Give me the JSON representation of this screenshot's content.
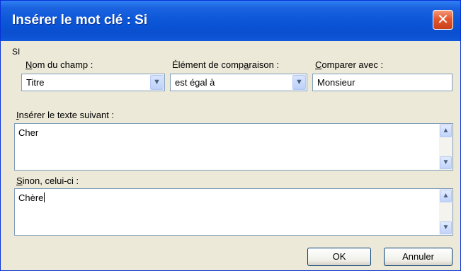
{
  "dialog": {
    "title": "Insérer le mot clé : Si",
    "close_glyph": "✕"
  },
  "group": {
    "label": "SI"
  },
  "fields": {
    "field_name": {
      "label_accel": "N",
      "label_rest": "om du champ :",
      "value": "Titre"
    },
    "comparison": {
      "label_before": "Élément de comp",
      "label_accel": "a",
      "label_rest": "raison :",
      "value": "est égal à"
    },
    "compare_with": {
      "label_accel": "C",
      "label_rest": "omparer avec :",
      "value": "Monsieur"
    }
  },
  "insert_text": {
    "label_accel": "I",
    "label_rest": "nsérer le texte suivant :",
    "value": "Cher"
  },
  "otherwise": {
    "label_accel": "S",
    "label_rest": "inon, celui-ci :",
    "value": "Chère"
  },
  "buttons": {
    "ok": "OK",
    "cancel": "Annuler"
  },
  "icons": {
    "dropdown": "chevron-down-icon",
    "scroll_up": "arrow-up-icon",
    "scroll_down": "arrow-down-icon",
    "close": "close-icon"
  }
}
